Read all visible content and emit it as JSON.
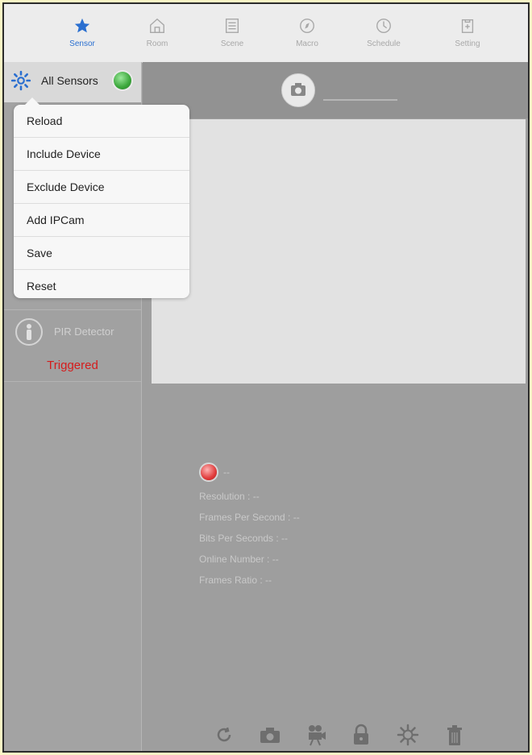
{
  "tabs": [
    {
      "label": "Sensor",
      "icon": "star-icon",
      "active": true
    },
    {
      "label": "Room",
      "icon": "house-icon",
      "active": false
    },
    {
      "label": "Scene",
      "icon": "list-icon",
      "active": false
    },
    {
      "label": "Macro",
      "icon": "compass-icon",
      "active": false
    },
    {
      "label": "Schedule",
      "icon": "clock-icon",
      "active": false
    },
    {
      "label": "Setting",
      "icon": "clipboard-icon",
      "active": false
    }
  ],
  "sidebar": {
    "header_title": "All Sensors",
    "sensor": {
      "name": "PIR Detector",
      "status": "Triggered"
    }
  },
  "menu": {
    "items": [
      "Reload",
      "Include Device",
      "Exclude Device",
      "Add IPCam",
      "Save",
      "Reset"
    ]
  },
  "camera": {
    "name_dash": "--",
    "resolution": "Resolution : --",
    "fps": "Frames Per Second : --",
    "bps": "Bits Per Seconds : --",
    "online": "Online Number : --",
    "ratio": "Frames Ratio : --"
  },
  "toolbar": [
    "refresh-icon",
    "camera-icon",
    "video-camera-icon",
    "lock-icon",
    "gear-icon",
    "trash-icon"
  ],
  "colors": {
    "accent": "#2a6fd0",
    "triggered": "#d51c1c",
    "online": "#3aa63a",
    "offline": "#e03b3b"
  }
}
